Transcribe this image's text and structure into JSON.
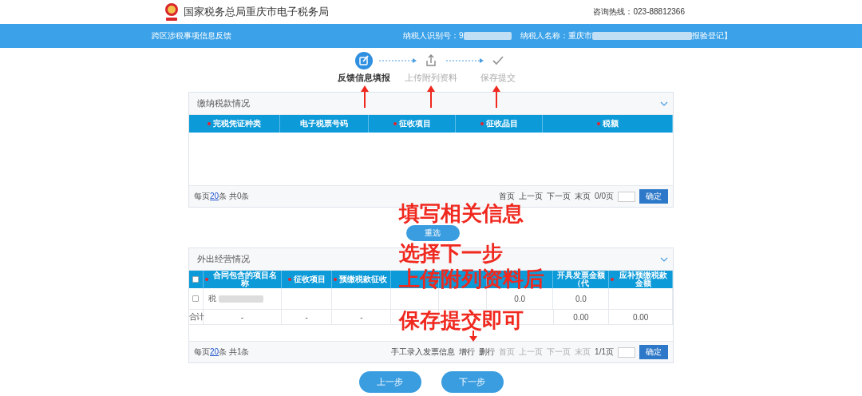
{
  "header": {
    "title": "国家税务总局重庆市电子税务局",
    "hotline": "咨询热线：023-88812366"
  },
  "info_bar": {
    "page_title": "跨区涉税事项信息反馈",
    "fields": [
      {
        "label": "纳税人识别号：9",
        "redacted": true
      },
      {
        "label": "纳税人名称：重庆市",
        "redacted": true,
        "suffix": "报验登记】"
      }
    ]
  },
  "steps": [
    {
      "label": "反馈信息填报",
      "kind": "edit",
      "selected": true
    },
    {
      "label": "上传附列资料",
      "kind": "upload",
      "selected": false
    },
    {
      "label": "保存提交",
      "kind": "check",
      "selected": false
    }
  ],
  "panels": [
    {
      "title": "缴纳税款情况",
      "columns": [
        {
          "label": "完税凭证种类",
          "required": true
        },
        {
          "label": "电子税票号码",
          "required": false
        },
        {
          "label": "征收项目",
          "required": true
        },
        {
          "label": "征收品目",
          "required": true
        },
        {
          "label": "税额",
          "required": true
        }
      ],
      "footer": {
        "summary_before": "每页",
        "page_size": "20",
        "summary_after": "条 共0条",
        "pager": [
          {
            "label": "首页",
            "disabled": false
          },
          {
            "label": "上一页",
            "disabled": false
          },
          {
            "label": "下一页",
            "disabled": false
          },
          {
            "label": "末页",
            "disabled": false
          }
        ],
        "page_info": "0/0页",
        "confirm": "确定"
      },
      "action_button": "重选"
    },
    {
      "title": "外出经营情况",
      "select_all": {
        "checked": false
      },
      "columns": [
        {
          "label": "合同包含的项目名称",
          "required": true
        },
        {
          "label": "征收项目",
          "required": true
        },
        {
          "label": "预缴税款征收",
          "required": true
        },
        {
          "required": false
        },
        {
          "required": false
        },
        {
          "required": false
        },
        {
          "label": "开具发票金额（代",
          "required": false
        },
        {
          "label": "应补预缴税款金额",
          "required": true
        }
      ],
      "rows": [
        {
          "kind": "item",
          "checked": false,
          "redacted": true,
          "cells": [
            "税",
            null,
            null,
            null,
            null,
            "0.0",
            "0.0",
            null
          ]
        },
        {
          "kind": "total",
          "label": "合计",
          "cells": [
            "-",
            "-",
            "-",
            null,
            null,
            null,
            "0.00",
            "0.00"
          ]
        }
      ],
      "footer": {
        "summary_before": "每页",
        "page_size": "20",
        "summary_after": "条 共1条",
        "tools": [
          "手工录入发票信息",
          "增行",
          "删行"
        ],
        "pager": [
          {
            "label": "首页",
            "disabled": true
          },
          {
            "label": "上一页",
            "disabled": true
          },
          {
            "label": "下一页",
            "disabled": true
          },
          {
            "label": "末页",
            "disabled": true
          }
        ],
        "page_info": "1/1页",
        "confirm": "确定"
      }
    }
  ],
  "nav_buttons": [
    "上一步",
    "下一步"
  ],
  "annotation": {
    "lines": [
      "填写相关信息",
      "选择下一步",
      "上传附列资料后",
      "保存提交即可"
    ]
  }
}
